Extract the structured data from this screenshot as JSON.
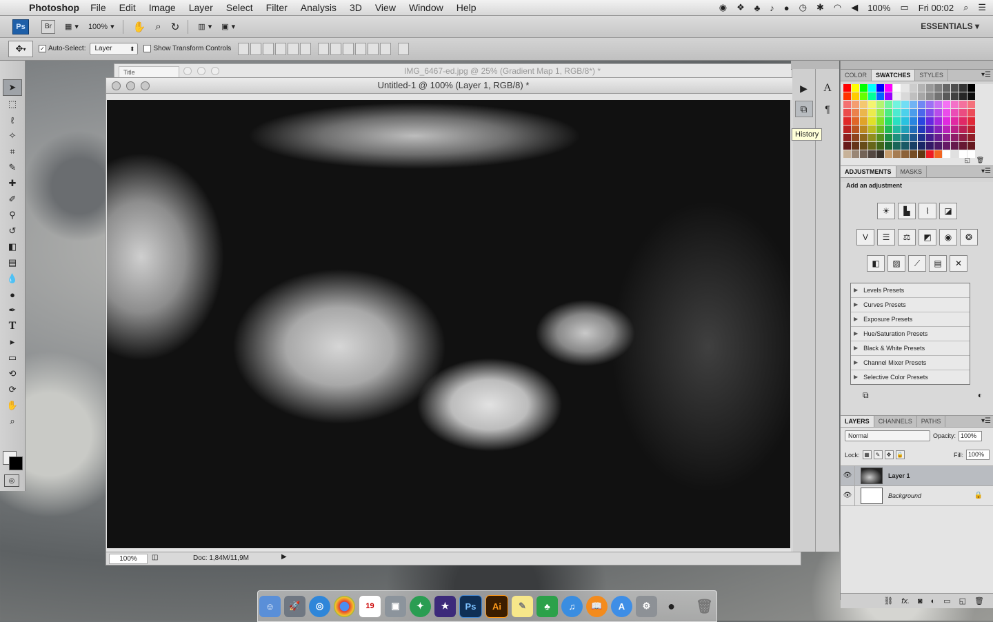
{
  "menubar": {
    "app_name": "Photoshop",
    "menus": [
      "File",
      "Edit",
      "Image",
      "Layer",
      "Select",
      "Filter",
      "Analysis",
      "3D",
      "View",
      "Window",
      "Help"
    ],
    "battery": "100%",
    "clock": "Fri 00:02"
  },
  "appbar": {
    "ps_label": "Ps",
    "br_label": "Br",
    "zoom": "100%",
    "workspace": "ESSENTIALS ▾"
  },
  "options": {
    "auto_select_label": "Auto-Select:",
    "auto_select_value": "Layer",
    "transform_label": "Show Transform Controls"
  },
  "bg_document": {
    "tab_label": "Title",
    "title": "IMG_6467-ed.jpg @ 25% (Gradient Map 1, RGB/8*) *"
  },
  "document": {
    "title": "Untitled-1 @ 100% (Layer 1, RGB/8) *",
    "zoom": "100%",
    "doc_info": "Doc: 1,84M/11,9M"
  },
  "tooltip": "History",
  "panels": {
    "color_tabs": [
      "COLOR",
      "SWATCHES",
      "STYLES"
    ],
    "adjust_tabs": [
      "ADJUSTMENTS",
      "MASKS"
    ],
    "adjust_title": "Add an adjustment",
    "presets": [
      "Levels Presets",
      "Curves Presets",
      "Exposure Presets",
      "Hue/Saturation Presets",
      "Black & White Presets",
      "Channel Mixer Presets",
      "Selective Color Presets"
    ],
    "layer_tabs": [
      "LAYERS",
      "CHANNELS",
      "PATHS"
    ],
    "blend_mode": "Normal",
    "opacity_label": "Opacity:",
    "opacity_value": "100%",
    "lock_label": "Lock:",
    "fill_label": "Fill:",
    "fill_value": "100%",
    "layers": [
      {
        "name": "Layer 1"
      },
      {
        "name": "Background"
      }
    ]
  },
  "colors": {
    "panel_bg": "#d5d5d5",
    "selected_layer": "#b9bcc1"
  }
}
